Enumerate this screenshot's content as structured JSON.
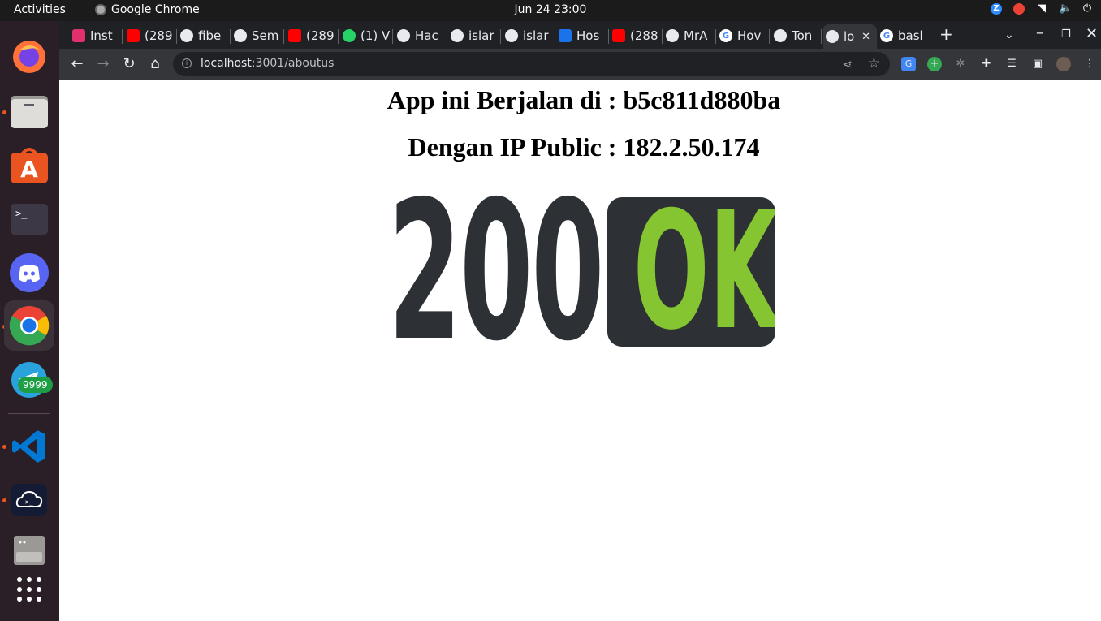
{
  "system": {
    "activities": "Activities",
    "app_name": "Google Chrome",
    "clock": "Jun 24  23:00"
  },
  "dock": {
    "items": [
      "firefox-icon",
      "files-icon",
      "app-center-icon",
      "terminal-icon",
      "discord-icon",
      "chrome-icon",
      "telegram-icon",
      "vscode-icon",
      "cloud-shell-icon",
      "disks-icon",
      "show-apps-icon"
    ],
    "telegram_badge": "9999"
  },
  "browser": {
    "tabs": [
      {
        "label": "Inst",
        "icon": "instagram-icon",
        "color": "#e1306c"
      },
      {
        "label": "(289",
        "icon": "youtube-icon",
        "color": "#ff0000"
      },
      {
        "label": "fibe",
        "icon": "github-icon",
        "color": "#e8eaed"
      },
      {
        "label": "Sem",
        "icon": "github-icon",
        "color": "#e8eaed"
      },
      {
        "label": "(289",
        "icon": "youtube-icon",
        "color": "#ff0000"
      },
      {
        "label": "(1) V",
        "icon": "whatsapp-icon",
        "color": "#25d366"
      },
      {
        "label": "Hac",
        "icon": "globe-icon",
        "color": "#e8eaed"
      },
      {
        "label": "islar",
        "icon": "github-icon",
        "color": "#e8eaed"
      },
      {
        "label": "islar",
        "icon": "github-icon",
        "color": "#e8eaed"
      },
      {
        "label": "Hos",
        "icon": "hosting-icon",
        "color": "#1a73e8"
      },
      {
        "label": "(288",
        "icon": "youtube-icon",
        "color": "#ff0000"
      },
      {
        "label": "MrA",
        "icon": "github-icon",
        "color": "#e8eaed"
      },
      {
        "label": "Hov",
        "icon": "google-icon",
        "color": "#4285f4"
      },
      {
        "label": "Ton",
        "icon": "github-icon",
        "color": "#e8eaed"
      },
      {
        "label": "lo",
        "icon": "globe-icon",
        "color": "#e8eaed",
        "active": true
      },
      {
        "label": "basl",
        "icon": "google-icon",
        "color": "#4285f4"
      }
    ],
    "new_tab": "+",
    "url_host": "localhost",
    "url_rest": ":3001/aboutus"
  },
  "page": {
    "line1": "App ini Berjalan di : b5c811d880ba",
    "line2": "Dengan IP Public : 182.2.50.174",
    "status_code": "200",
    "status_text": "OK",
    "colors": {
      "dark": "#2d3035",
      "ok_green": "#84c531"
    }
  }
}
